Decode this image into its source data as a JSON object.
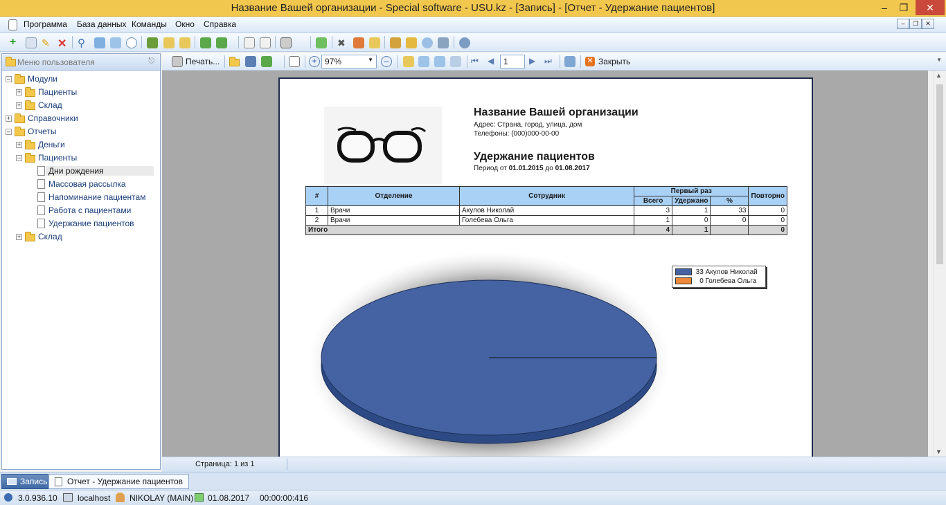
{
  "window": {
    "title": "Название Вашей организации - Special software - USU.kz - [Запись] - [Отчет - Удержание пациентов]"
  },
  "menu": {
    "items": [
      "Программа",
      "База данных",
      "Команды",
      "Окно",
      "Справка"
    ]
  },
  "sidebar": {
    "header": "Меню пользователя",
    "tree": [
      {
        "label": "Модули"
      },
      {
        "label": "Пациенты"
      },
      {
        "label": "Склад"
      },
      {
        "label": "Справочники"
      },
      {
        "label": "Отчеты"
      },
      {
        "label": "Деньги"
      },
      {
        "label": "Пациенты"
      },
      {
        "label": "Дни рождения"
      },
      {
        "label": "Массовая рассылка"
      },
      {
        "label": "Напоминание пациентам"
      },
      {
        "label": "Работа с пациентами"
      },
      {
        "label": "Удержание пациентов"
      },
      {
        "label": "Склад"
      }
    ]
  },
  "viewer_toolbar": {
    "print_label": "Печать...",
    "zoom": "97%",
    "page_number": "1",
    "close_label": "Закрыть"
  },
  "report": {
    "org_name": "Название Вашей организации",
    "address": "Адрес: Страна, город, улица, дом",
    "phones": "Телефоны: (000)000-00-00",
    "title": "Удержание пациентов",
    "period_prefix": "Период от",
    "date_from": "01.01.2015",
    "period_mid": "до",
    "date_to": "01.08.2017",
    "columns": {
      "num": "#",
      "department": "Отделение",
      "employee": "Сотрудник",
      "first_time": "Первый раз",
      "total": "Всего",
      "retained": "Удержано",
      "percent": "%",
      "repeat": "Повторно"
    },
    "rows": [
      {
        "n": "1",
        "department": "Врачи",
        "employee": "Акулов Николай",
        "total": "3",
        "retained": "1",
        "percent": "33",
        "repeat": "0"
      },
      {
        "n": "2",
        "department": "Врачи",
        "employee": "Голебева Ольга",
        "total": "1",
        "retained": "0",
        "percent": "0",
        "repeat": "0"
      }
    ],
    "totals": {
      "label": "Итого",
      "total": "4",
      "retained": "1",
      "percent": "",
      "repeat": "0"
    }
  },
  "chart_data": {
    "type": "pie",
    "categories": [
      "Акулов Николай",
      "Голебева Ольга"
    ],
    "values": [
      33,
      0
    ],
    "legend": [
      {
        "value": "33",
        "label": "Акулов Николай",
        "color": "#4563a2"
      },
      {
        "value": "0",
        "label": "Голебева Ольга",
        "color": "#f0883a"
      }
    ],
    "legend_position": "top-right"
  },
  "status": {
    "page_info": "Страница: 1 из 1"
  },
  "tabs": [
    {
      "label": "Запись"
    },
    {
      "label": "Отчет - Удержание пациентов"
    }
  ],
  "bottom": {
    "version": "3.0.936.10",
    "host": "localhost",
    "user": "NIKOLAY (MAIN)",
    "date": "01.08.2017",
    "timer": "00:00:00:416"
  }
}
